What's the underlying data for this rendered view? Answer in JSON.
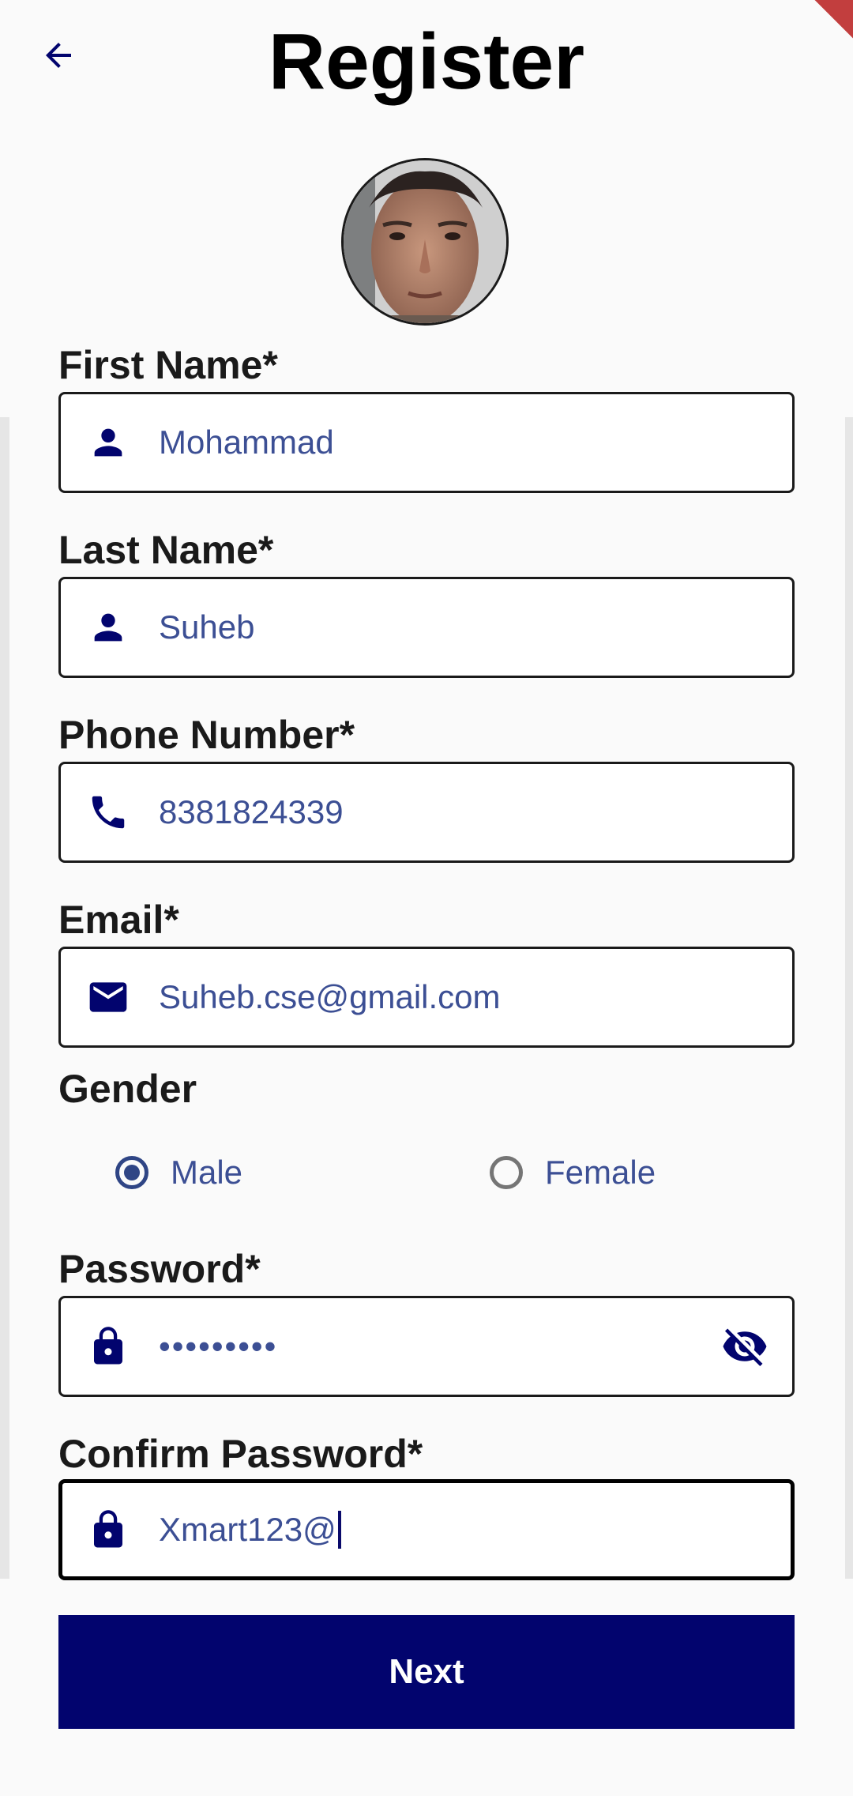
{
  "header": {
    "title": "Register",
    "back_icon": "arrow-back-icon"
  },
  "colors": {
    "primary": "#02046e",
    "value_text": "#3c4f94",
    "background": "#fafafa"
  },
  "form": {
    "first_name": {
      "label": "First Name*",
      "value": "Mohammad",
      "icon": "person-icon"
    },
    "last_name": {
      "label": "Last Name*",
      "value": "Suheb",
      "icon": "person-icon"
    },
    "phone": {
      "label": "Phone Number*",
      "value": "8381824339",
      "icon": "phone-icon"
    },
    "email": {
      "label": "Email*",
      "value": "Suheb.cse@gmail.com",
      "icon": "mail-icon"
    },
    "gender": {
      "label": "Gender",
      "options": [
        "Male",
        "Female"
      ],
      "selected": "Male"
    },
    "password": {
      "label": "Password*",
      "value": "•••••••••",
      "icon": "lock-icon",
      "toggle_icon": "eye-off-icon"
    },
    "confirm_password": {
      "label": "Confirm Password*",
      "value": "Xmart123@",
      "icon": "lock-icon"
    }
  },
  "actions": {
    "next_label": "Next"
  }
}
